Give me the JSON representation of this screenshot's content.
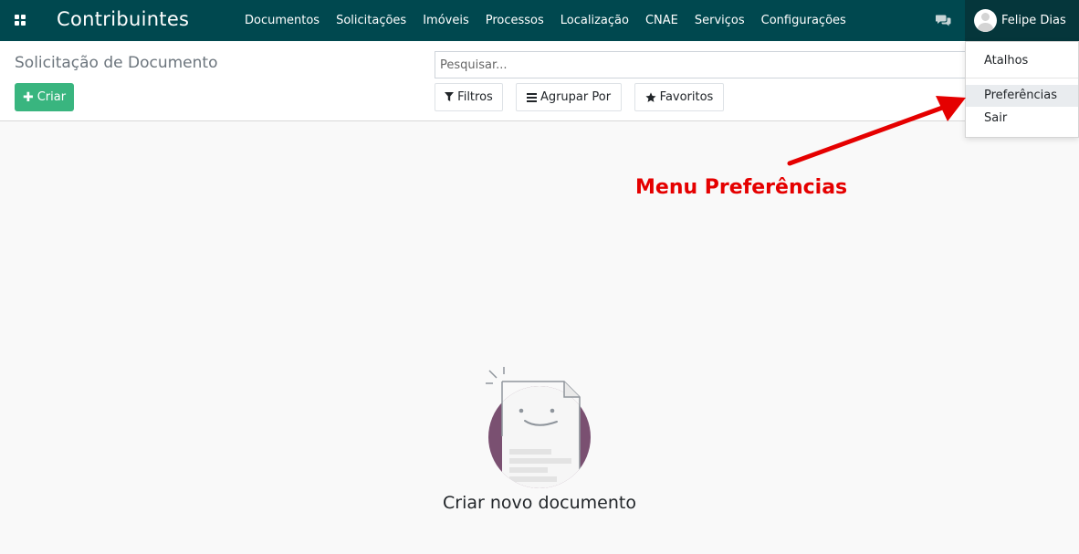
{
  "navbar": {
    "brand": "Contribuintes",
    "menu": [
      {
        "label": "Documentos"
      },
      {
        "label": "Solicitações"
      },
      {
        "label": "Imóveis"
      },
      {
        "label": "Processos"
      },
      {
        "label": "Localização"
      },
      {
        "label": "CNAE"
      },
      {
        "label": "Serviços"
      },
      {
        "label": "Configurações"
      }
    ],
    "apps_icon": "grid-icon",
    "chat_icon": "chat-icon",
    "user_name": "Felipe Dias",
    "background": "#00484f",
    "user_background": "#05363b"
  },
  "control_panel": {
    "breadcrumb": "Solicitação de Documento",
    "create_label": "Criar",
    "search_placeholder": "Pesquisar...",
    "filters_label": "Filtros",
    "group_label": "Agrupar Por",
    "favorites_label": "Favoritos",
    "create_color": "#39b57f"
  },
  "user_menu": {
    "items": [
      {
        "label": "Atalhos"
      },
      {
        "label": "Preferências",
        "highlighted": true
      },
      {
        "label": "Sair"
      }
    ]
  },
  "annotation": {
    "text": "Menu Preferências",
    "color": "#e50000"
  },
  "empty_state": {
    "title": "Criar novo documento"
  }
}
